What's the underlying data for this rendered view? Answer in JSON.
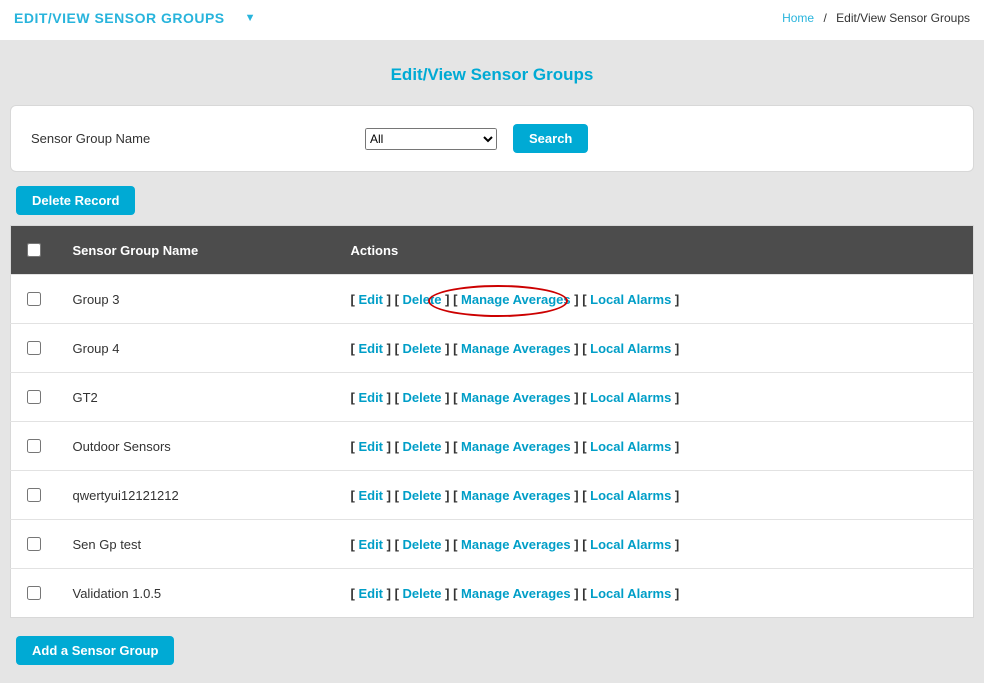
{
  "header": {
    "title": "EDIT/VIEW SENSOR GROUPS",
    "breadcrumb_home": "Home",
    "breadcrumb_sep": "/",
    "breadcrumb_current": "Edit/View Sensor Groups"
  },
  "page_title": "Edit/View Sensor Groups",
  "filter": {
    "label": "Sensor Group Name",
    "select_value": "All",
    "search_btn": "Search"
  },
  "buttons": {
    "delete_record": "Delete Record",
    "add_group": "Add a Sensor Group"
  },
  "table": {
    "col_name": "Sensor Group Name",
    "col_actions": "Actions",
    "actions": {
      "edit": "Edit",
      "del": "Delete",
      "manage": "Manage Averages",
      "alarms": "Local Alarms"
    },
    "rows": [
      {
        "name": "Group 3"
      },
      {
        "name": "Group 4"
      },
      {
        "name": "GT2"
      },
      {
        "name": "Outdoor Sensors"
      },
      {
        "name": "qwertyui12121212"
      },
      {
        "name": "Sen Gp test"
      },
      {
        "name": "Validation 1.0.5"
      }
    ]
  },
  "annotation": {
    "target_row_index": 0,
    "target_action": "manage"
  }
}
